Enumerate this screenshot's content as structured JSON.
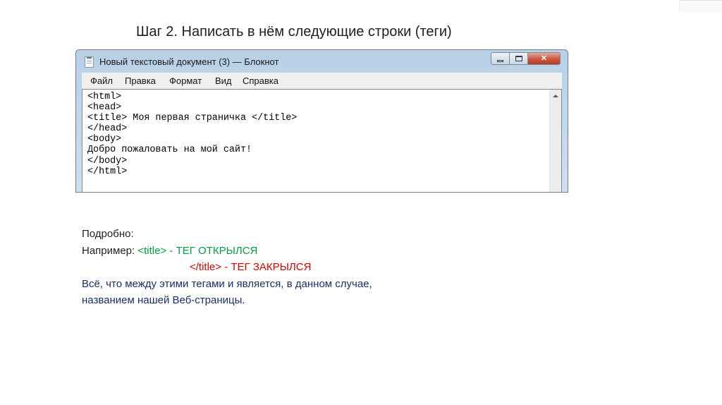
{
  "slide": {
    "title": "Шаг 2. Написать в нём следующие строки (теги)"
  },
  "window": {
    "title": "Новый текстовый документ (3) — Блокнот",
    "app_icon": "notepad-icon",
    "controls": {
      "minimize": "minimize-icon",
      "maximize": "maximize-icon",
      "close": "✕"
    },
    "menu": [
      "Файл",
      "Правка",
      "Формат",
      "Вид",
      "Справка"
    ],
    "editor_lines": [
      "<html>",
      "<head>",
      "<title> Моя первая страничка </title>",
      "</head>",
      "<body>",
      "Добро пожаловать на мой сайт!",
      "</body>",
      "</html>"
    ]
  },
  "notes": {
    "heading": "Подробно:",
    "example_prefix": "Например: ",
    "open_tag": "<title>",
    "open_desc": " - ТЕГ ОТКРЫЛСЯ",
    "close_tag": "</title>",
    "close_desc": " - ТЕГ ЗАКРЫЛСЯ",
    "explanation_1": "Всё, что между этими тегами и является, в данном случае,",
    "explanation_2": "названием нашей Веб-страницы."
  },
  "colors": {
    "open_tag": "#00a03c",
    "close_tag": "#e00000",
    "explanation": "#1a2e6e"
  }
}
